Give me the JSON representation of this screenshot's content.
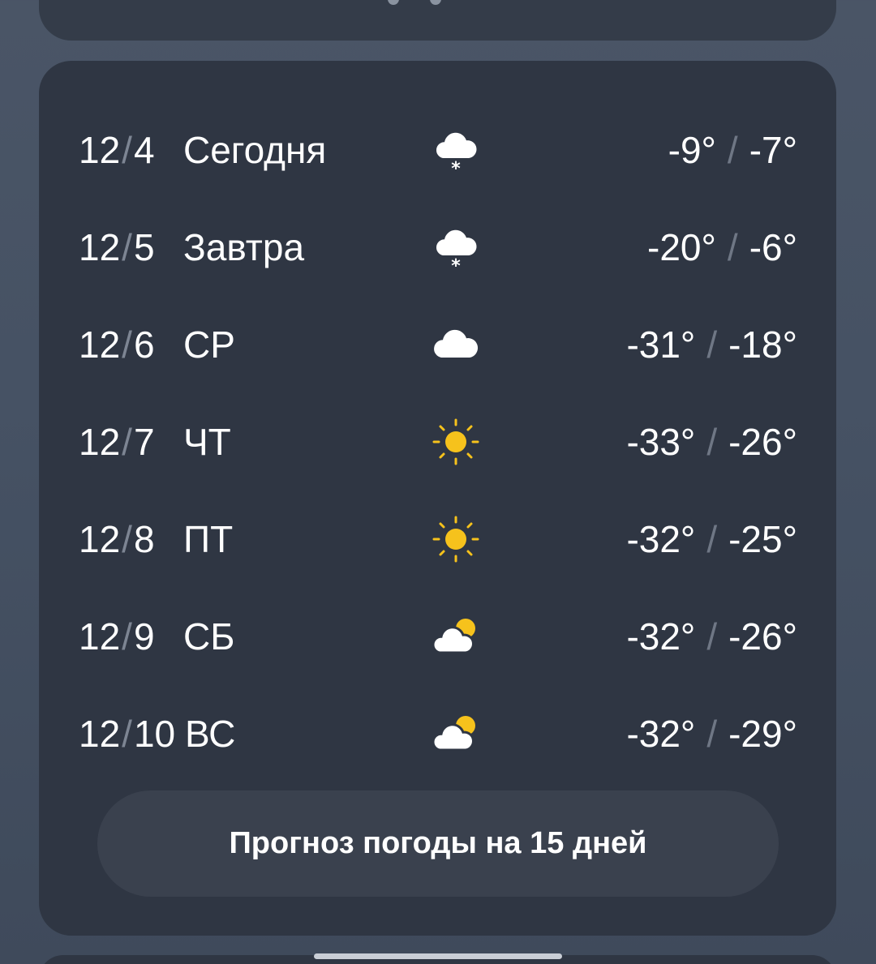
{
  "forecast": {
    "rows": [
      {
        "month": "12",
        "day_num": "4",
        "day": "Сегодня",
        "icon": "snow-cloud-icon",
        "low": "-9°",
        "high": "-7°"
      },
      {
        "month": "12",
        "day_num": "5",
        "day": "Завтра",
        "icon": "snow-cloud-icon",
        "low": "-20°",
        "high": "-6°"
      },
      {
        "month": "12",
        "day_num": "6",
        "day": "СР",
        "icon": "cloud-icon",
        "low": "-31°",
        "high": "-18°"
      },
      {
        "month": "12",
        "day_num": "7",
        "day": "ЧТ",
        "icon": "sun-icon",
        "low": "-33°",
        "high": "-26°"
      },
      {
        "month": "12",
        "day_num": "8",
        "day": "ПТ",
        "icon": "sun-icon",
        "low": "-32°",
        "high": "-25°"
      },
      {
        "month": "12",
        "day_num": "9",
        "day": "СБ",
        "icon": "partly-cloudy-icon",
        "low": "-32°",
        "high": "-26°"
      },
      {
        "month": "12",
        "day_num": "10",
        "day": "ВС",
        "icon": "partly-cloudy-icon",
        "low": "-32°",
        "high": "-29°"
      }
    ],
    "more_button_label": "Прогноз погоды на 15 дней"
  },
  "colors": {
    "card_bg": "#2f3643",
    "sun": "#f6c21c",
    "cloud": "#ffffff",
    "separator": "#6f7785"
  }
}
